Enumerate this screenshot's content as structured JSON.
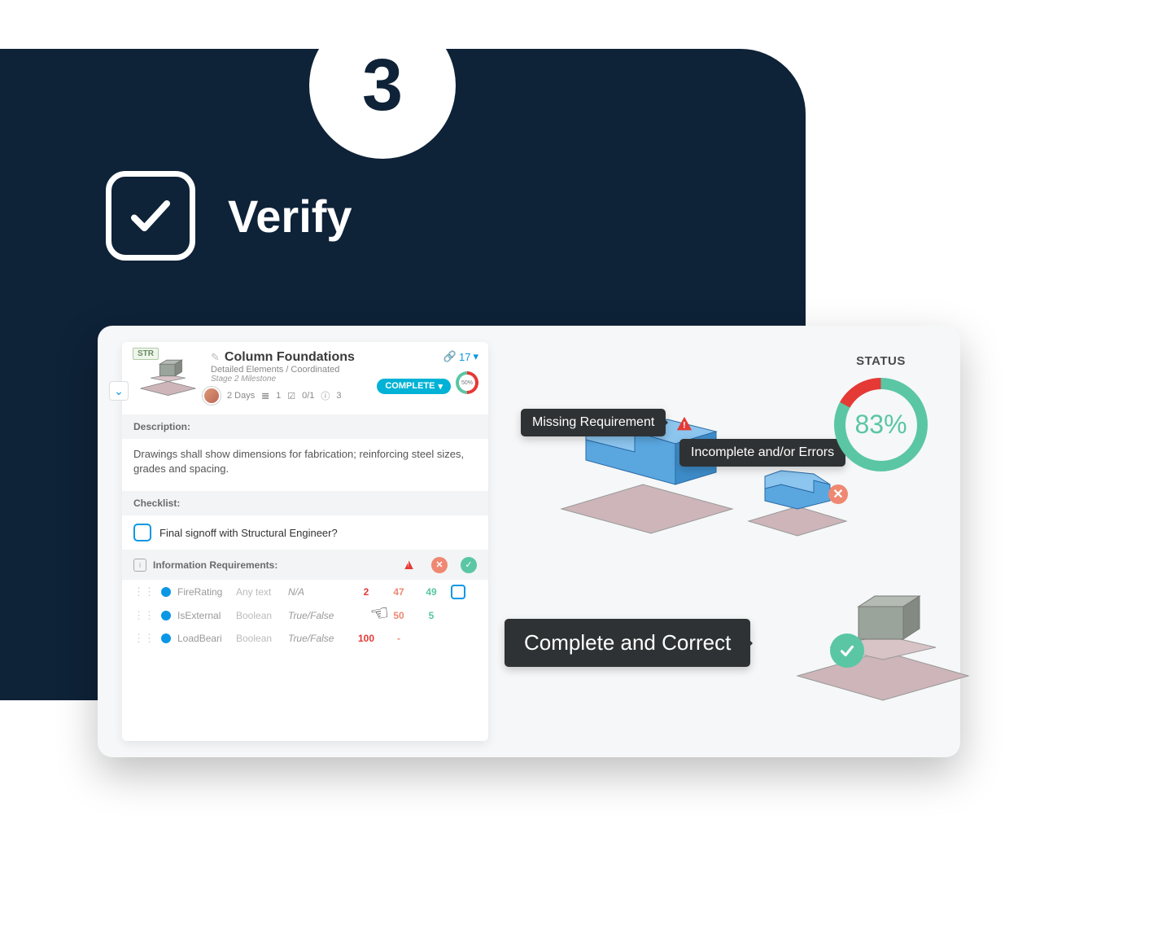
{
  "step_number": "3",
  "title": "Verify",
  "card": {
    "tag": "STR",
    "title": "Column Foundations",
    "subtitle": "Detailed Elements / Coordinated",
    "stage": "Stage 2 Milestone",
    "duration": "2 Days",
    "attach_count": "1",
    "check_count": "0/1",
    "info_count": "3",
    "link_count": "17",
    "status_badge": "COMPLETE",
    "progress_label": "50%",
    "description_label": "Description:",
    "description_text": "Drawings shall show dimensions for fabrication; reinforcing steel sizes, grades and spacing.",
    "checklist_label": "Checklist:",
    "checklist_item": "Final signoff with Structural Engineer?",
    "req_label": "Information Requirements:",
    "rows": [
      {
        "name": "FireRating",
        "type": "Any text",
        "value": "N/A",
        "warn": "2",
        "err": "47",
        "ok": "49"
      },
      {
        "name": "IsExternal",
        "type": "Boolean",
        "value": "True/False",
        "warn": "",
        "err": "50",
        "ok": "5"
      },
      {
        "name": "LoadBeari",
        "type": "Boolean",
        "value": "True/False",
        "warn": "100",
        "err": "-",
        "ok": ""
      }
    ]
  },
  "tooltips": {
    "missing": "Missing Requirement",
    "incomplete": "Incomplete and/or Errors",
    "complete": "Complete and Correct"
  },
  "status": {
    "label": "STATUS",
    "percent": "83%"
  },
  "chart_data": {
    "type": "pie",
    "title": "STATUS",
    "series": [
      {
        "name": "Complete",
        "value": 83,
        "color": "#5ac6a4"
      },
      {
        "name": "Incomplete/Error",
        "value": 17,
        "color": "#e53935"
      }
    ]
  }
}
